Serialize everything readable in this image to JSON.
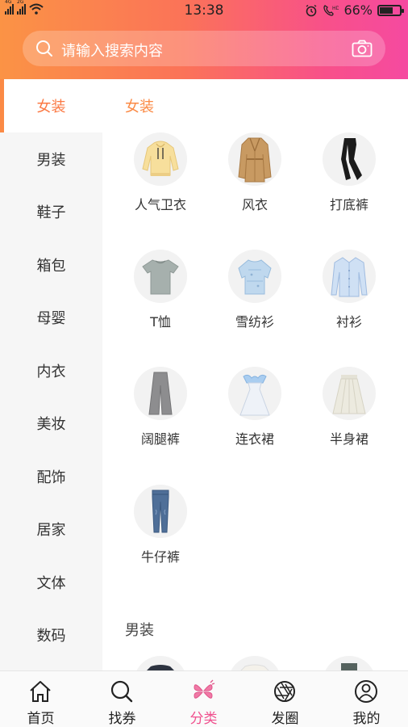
{
  "status_bar": {
    "time": "13:38",
    "battery": "66%",
    "battery_level": 0.66,
    "network_labels": [
      "4G",
      "2G"
    ]
  },
  "search": {
    "placeholder": "请输入搜索内容"
  },
  "sidebar": {
    "items": [
      {
        "label": "女装",
        "active": true
      },
      {
        "label": "男装",
        "active": false
      },
      {
        "label": "鞋子",
        "active": false
      },
      {
        "label": "箱包",
        "active": false
      },
      {
        "label": "母婴",
        "active": false
      },
      {
        "label": "内衣",
        "active": false
      },
      {
        "label": "美妆",
        "active": false
      },
      {
        "label": "配饰",
        "active": false
      },
      {
        "label": "居家",
        "active": false
      },
      {
        "label": "文体",
        "active": false
      },
      {
        "label": "数码",
        "active": false
      }
    ]
  },
  "content": {
    "sections": [
      {
        "title": "女装",
        "items": [
          {
            "label": "人气卫衣",
            "icon": "hoodie-icon"
          },
          {
            "label": "风衣",
            "icon": "trench-coat-icon"
          },
          {
            "label": "打底裤",
            "icon": "leggings-icon"
          },
          {
            "label": "T恤",
            "icon": "tshirt-icon"
          },
          {
            "label": "雪纺衫",
            "icon": "chiffon-blouse-icon"
          },
          {
            "label": "衬衫",
            "icon": "shirt-icon"
          },
          {
            "label": "阔腿裤",
            "icon": "wide-leg-pants-icon"
          },
          {
            "label": "连衣裙",
            "icon": "dress-icon"
          },
          {
            "label": "半身裙",
            "icon": "skirt-icon"
          },
          {
            "label": "牛仔裤",
            "icon": "jeans-icon"
          }
        ]
      },
      {
        "title": "男装",
        "items": []
      }
    ]
  },
  "tabbar": {
    "tabs": [
      {
        "label": "首页",
        "icon": "home-icon",
        "active": false
      },
      {
        "label": "找券",
        "icon": "search-coupon-icon",
        "active": false
      },
      {
        "label": "分类",
        "icon": "category-icon",
        "active": true
      },
      {
        "label": "发圈",
        "icon": "aperture-icon",
        "active": false
      },
      {
        "label": "我的",
        "icon": "profile-icon",
        "active": false
      }
    ]
  },
  "colors": {
    "accent": "#fb8a45",
    "tab_active": "#f0508e",
    "gradient_start": "#fb9345",
    "gradient_end": "#f54aa0"
  }
}
